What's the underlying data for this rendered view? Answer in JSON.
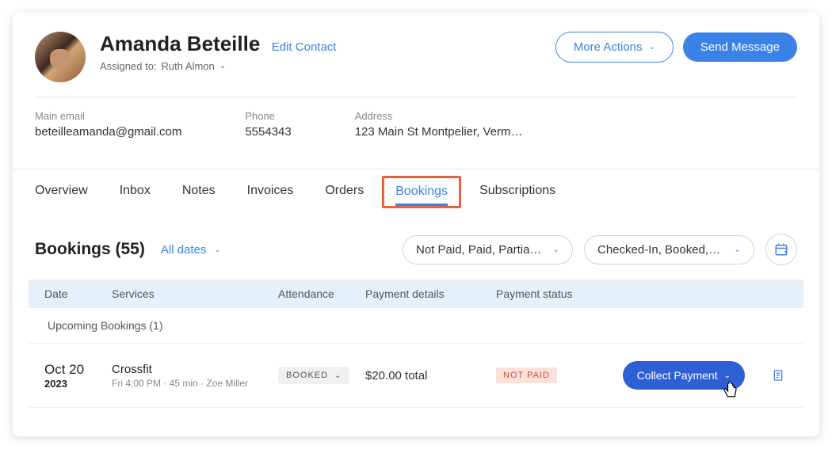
{
  "contact": {
    "name": "Amanda Beteille",
    "edit_label": "Edit Contact",
    "assigned_prefix": "Assigned to:",
    "assigned_to": "Ruth Almon"
  },
  "header_actions": {
    "more": "More Actions",
    "send_message": "Send Message"
  },
  "info": {
    "email_label": "Main email",
    "email_value": "beteilleamanda@gmail.com",
    "phone_label": "Phone",
    "phone_value": "5554343",
    "address_label": "Address",
    "address_value": "123 Main St Montpelier, Vermo…"
  },
  "tabs": {
    "overview": "Overview",
    "inbox": "Inbox",
    "notes": "Notes",
    "invoices": "Invoices",
    "orders": "Orders",
    "bookings": "Bookings",
    "subscriptions": "Subscriptions"
  },
  "bookings": {
    "title": "Bookings (55)",
    "date_filter": "All dates",
    "payment_filter": "Not Paid, Paid, Partia…",
    "status_filter": "Checked-In, Booked,…",
    "columns": {
      "date": "Date",
      "services": "Services",
      "attendance": "Attendance",
      "payment": "Payment details",
      "status": "Payment status"
    },
    "section_label": "Upcoming Bookings (1)",
    "row": {
      "day": "Oct 20",
      "year": "2023",
      "service": "Crossfit",
      "meta": "Fri 4:00 PM · 45 min · Zoe Miller",
      "attendance": "BOOKED",
      "payment": "$20.00 total",
      "status": "NOT PAID",
      "collect": "Collect Payment"
    }
  }
}
